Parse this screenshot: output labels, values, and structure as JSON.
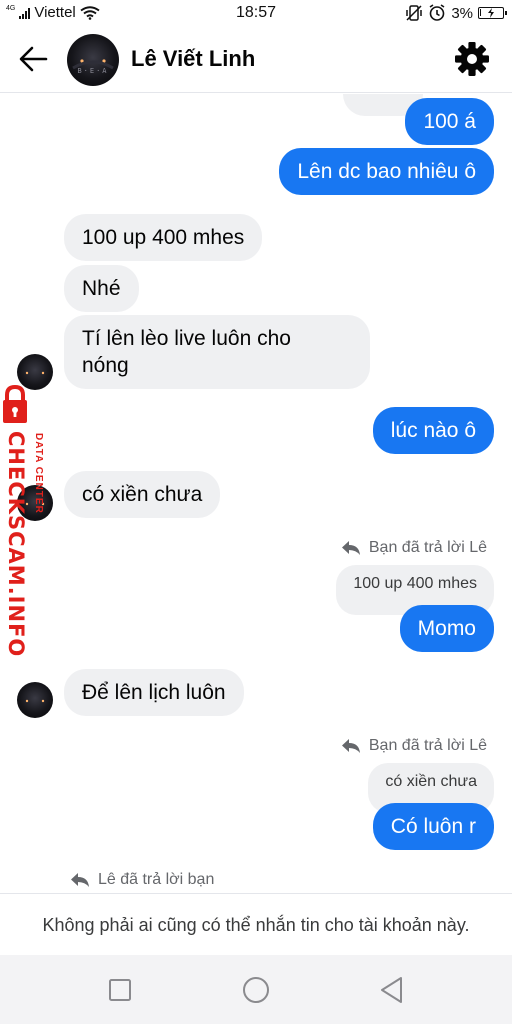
{
  "status_bar": {
    "network_label": "4G",
    "carrier": "Viettel",
    "time": "18:57",
    "battery": "3%",
    "battery_level": 0.03
  },
  "header": {
    "contact_name": "Lê Viết Linh",
    "back_icon": "arrow-left-icon",
    "settings_icon": "gear-icon",
    "avatar_caption": "B·E·A"
  },
  "messages": [
    {
      "from": "me",
      "text": "100 á"
    },
    {
      "from": "me",
      "text": "Lên dc bao nhiêu ô"
    },
    {
      "from": "them",
      "text": "100 up 400 mhes"
    },
    {
      "from": "them",
      "text": "Nhé"
    },
    {
      "from": "them",
      "text_line1": "Tí lên lèo live luôn cho",
      "text_line2": "nóng"
    },
    {
      "from": "me",
      "text": "lúc nào ô"
    },
    {
      "from": "them",
      "text": "có xiền chưa"
    },
    {
      "from": "me",
      "reply_note": "Bạn đã trả lời Lê",
      "quoted": "100 up 400 mhes",
      "text": "Momo"
    },
    {
      "from": "them",
      "text": "Để lên lịch luôn"
    },
    {
      "from": "me",
      "reply_note": "Bạn đã trả lời Lê",
      "quoted": "có xiền chưa",
      "text": "Có luôn r"
    },
    {
      "from": "them",
      "reply_note": "Lê đã trả lời bạn"
    }
  ],
  "watermark": {
    "main": "CHECKSCAM.INFO",
    "sub": "DATA CENTER"
  },
  "footer": {
    "notice": "Không phải ai cũng có thể nhắn tin cho tài khoản này."
  },
  "colors": {
    "outgoing_bubble": "#1877f2",
    "incoming_bubble": "#eff0f2",
    "watermark": "#e0201b"
  }
}
